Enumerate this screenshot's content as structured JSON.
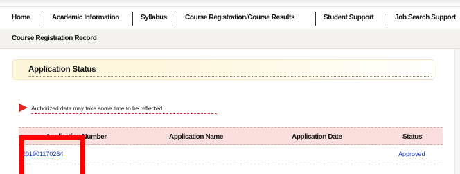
{
  "nav": {
    "items": [
      {
        "label": "Home"
      },
      {
        "label": "Academic Information"
      },
      {
        "label": "Syllabus"
      },
      {
        "label": "Course Registration/Course Results"
      },
      {
        "label": "Student Support"
      },
      {
        "label": "Job Search Support"
      }
    ]
  },
  "subnav": {
    "label": "Course Registration Record"
  },
  "section": {
    "title": "Application Status"
  },
  "notice": {
    "text": "Authorized data may take some time to be reflected."
  },
  "table": {
    "columns": [
      "Application Number",
      "Application Name",
      "Application Date",
      "Status"
    ],
    "rows": [
      {
        "application_number": "201901170264",
        "application_name": "",
        "application_date": "",
        "status": "Approved"
      }
    ]
  },
  "colors": {
    "accent_red": "#ff0000",
    "link_blue": "#1a3cc8",
    "header_pink": "#fbdede",
    "status_box_yellow": "#fdf6d8"
  }
}
